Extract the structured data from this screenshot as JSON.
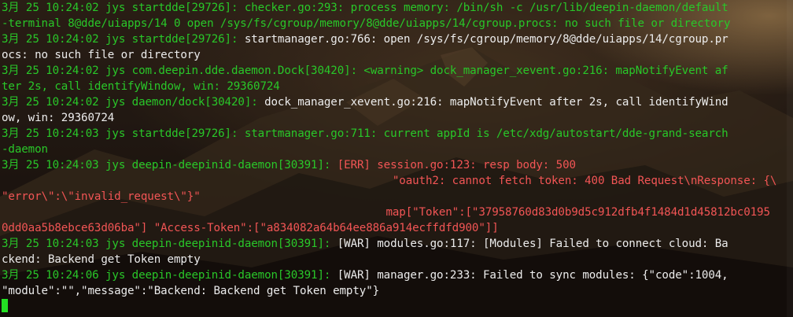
{
  "terminal": {
    "lines": [
      [
        {
          "c": "g",
          "t": "3月 25 10:24:02 jys startdde[29726]: "
        },
        {
          "c": "g",
          "t": "checker.go:293: process memory: /bin/sh -c /usr/lib/deepin-daemon/default"
        }
      ],
      [
        {
          "c": "g",
          "t": "-terminal 8@dde/uiapps/14 0 open /sys/fs/cgroup/memory/8@dde/uiapps/14/cgroup.procs: no such file or directory"
        }
      ],
      [
        {
          "c": "g",
          "t": "3月 25 10:24:02 jys startdde[29726]: "
        },
        {
          "c": "w",
          "t": "startmanager.go:766: open /sys/fs/cgroup/memory/8@dde/uiapps/14/cgroup.pr"
        }
      ],
      [
        {
          "c": "w",
          "t": "ocs: no such file or directory"
        }
      ],
      [
        {
          "c": "g",
          "t": "3月 25 10:24:02 jys com.deepin.dde.daemon.Dock[30420]: <warning> dock_manager_xevent.go:216: mapNotifyEvent af"
        }
      ],
      [
        {
          "c": "g",
          "t": "ter 2s, call identifyWindow, win: 29360724"
        }
      ],
      [
        {
          "c": "g",
          "t": "3月 25 10:24:02 jys daemon/dock[30420]: "
        },
        {
          "c": "w",
          "t": "dock_manager_xevent.go:216: mapNotifyEvent after 2s, call identifyWind"
        }
      ],
      [
        {
          "c": "w",
          "t": "ow, win: 29360724"
        }
      ],
      [
        {
          "c": "g",
          "t": "3月 25 10:24:03 jys startdde[29726]: startmanager.go:711: current appId is /etc/xdg/autostart/dde-grand-search"
        }
      ],
      [
        {
          "c": "g",
          "t": "-daemon"
        }
      ],
      [
        {
          "c": "g",
          "t": "3月 25 10:24:03 jys deepin-deepinid-daemon[30391]: "
        },
        {
          "c": "r",
          "t": "[ERR] session.go:123: resp body: 500"
        }
      ],
      [
        {
          "c": "r",
          "t": "                                                           \"oauth2: cannot fetch token: 400 Bad Request\\nResponse: {\\"
        }
      ],
      [
        {
          "c": "r",
          "t": "\"error\\\":\\\"invalid_request\\\"}\""
        }
      ],
      [
        {
          "c": "r",
          "t": "                                                          map[\"Token\":[\"37958760d83d0b9d5c912dfb4f1484d1d45812bc0195"
        }
      ],
      [
        {
          "c": "r",
          "t": "0dd0aa5b8ebce63d06ba\"] \"Access-Token\":[\"a834082a64b64ee886a914ecffdfd900\"]]"
        }
      ],
      [
        {
          "c": "g",
          "t": "3月 25 10:24:03 jys deepin-deepinid-daemon[30391]: "
        },
        {
          "c": "w",
          "t": "[WAR] modules.go:117: [Modules] Failed to connect cloud: Ba"
        }
      ],
      [
        {
          "c": "w",
          "t": "ckend: Backend get Token empty"
        }
      ],
      [
        {
          "c": "g",
          "t": "3月 25 10:24:06 jys deepin-deepinid-daemon[30391]: "
        },
        {
          "c": "w",
          "t": "[WAR] manager.go:233: Failed to sync modules: {\"code\":1004,"
        }
      ],
      [
        {
          "c": "w",
          "t": "\"module\":\"\",\"message\":\"Backend: Backend get Token empty\"}"
        }
      ]
    ]
  }
}
